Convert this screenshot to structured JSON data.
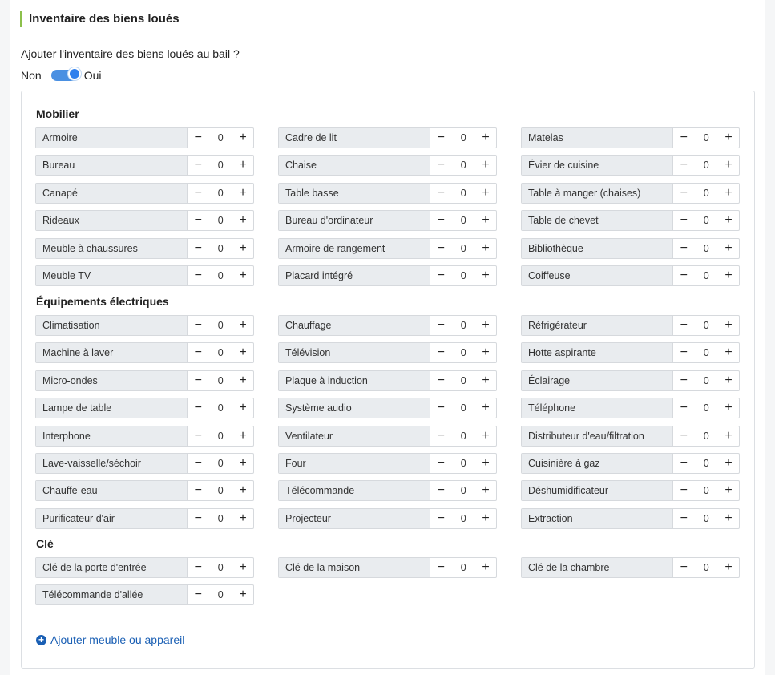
{
  "header": {
    "title": "Inventaire des biens loués"
  },
  "question": "Ajouter l'inventaire des biens loués au bail ?",
  "toggle": {
    "off_label": "Non",
    "on_label": "Oui",
    "value": true
  },
  "sections": [
    {
      "title": "Mobilier",
      "items": [
        {
          "label": "Armoire",
          "value": "0"
        },
        {
          "label": "Cadre de lit",
          "value": "0"
        },
        {
          "label": "Matelas",
          "value": "0"
        },
        {
          "label": "Bureau",
          "value": "0"
        },
        {
          "label": "Chaise",
          "value": "0"
        },
        {
          "label": "Évier de cuisine",
          "value": "0"
        },
        {
          "label": "Canapé",
          "value": "0"
        },
        {
          "label": "Table basse",
          "value": "0"
        },
        {
          "label": "Table à manger (chaises)",
          "value": "0"
        },
        {
          "label": "Rideaux",
          "value": "0"
        },
        {
          "label": "Bureau d'ordinateur",
          "value": "0"
        },
        {
          "label": "Table de chevet",
          "value": "0"
        },
        {
          "label": "Meuble à chaussures",
          "value": "0"
        },
        {
          "label": "Armoire de rangement",
          "value": "0"
        },
        {
          "label": "Bibliothèque",
          "value": "0"
        },
        {
          "label": "Meuble TV",
          "value": "0"
        },
        {
          "label": "Placard intégré",
          "value": "0"
        },
        {
          "label": "Coiffeuse",
          "value": "0"
        }
      ]
    },
    {
      "title": "Équipements électriques",
      "items": [
        {
          "label": "Climatisation",
          "value": "0"
        },
        {
          "label": "Chauffage",
          "value": "0"
        },
        {
          "label": "Réfrigérateur",
          "value": "0"
        },
        {
          "label": "Machine à laver",
          "value": "0"
        },
        {
          "label": "Télévision",
          "value": "0"
        },
        {
          "label": "Hotte aspirante",
          "value": "0"
        },
        {
          "label": "Micro-ondes",
          "value": "0"
        },
        {
          "label": "Plaque à induction",
          "value": "0"
        },
        {
          "label": "Éclairage",
          "value": "0"
        },
        {
          "label": "Lampe de table",
          "value": "0"
        },
        {
          "label": "Système audio",
          "value": "0"
        },
        {
          "label": "Téléphone",
          "value": "0"
        },
        {
          "label": "Interphone",
          "value": "0"
        },
        {
          "label": "Ventilateur",
          "value": "0"
        },
        {
          "label": "Distributeur d'eau/filtration",
          "value": "0"
        },
        {
          "label": "Lave-vaisselle/séchoir",
          "value": "0"
        },
        {
          "label": "Four",
          "value": "0"
        },
        {
          "label": "Cuisinière à gaz",
          "value": "0"
        },
        {
          "label": "Chauffe-eau",
          "value": "0"
        },
        {
          "label": "Télécommande",
          "value": "0"
        },
        {
          "label": "Déshumidificateur",
          "value": "0"
        },
        {
          "label": "Purificateur d'air",
          "value": "0"
        },
        {
          "label": "Projecteur",
          "value": "0"
        },
        {
          "label": "Extraction",
          "value": "0"
        }
      ]
    },
    {
      "title": "Clé",
      "items": [
        {
          "label": "Clé de la porte d'entrée",
          "value": "0"
        },
        {
          "label": "Clé de la maison",
          "value": "0"
        },
        {
          "label": "Clé de la chambre",
          "value": "0"
        },
        {
          "label": "Télécommande d'allée",
          "value": "0"
        }
      ]
    }
  ],
  "add_button": {
    "label": "Ajouter meuble ou appareil"
  },
  "colors": {
    "accent_bar": "#8cc04b",
    "toggle": "#2f80ed",
    "link": "#1a5fb4",
    "label_bg": "#e9ecef"
  },
  "icons": {
    "decrement": "minus-icon",
    "increment": "plus-icon",
    "add": "plus-circle-icon"
  }
}
